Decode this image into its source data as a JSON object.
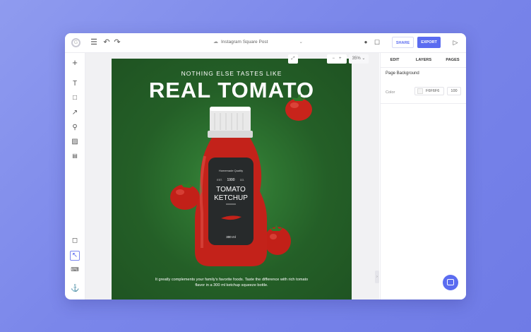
{
  "header": {
    "document_title": "Instagram Square Post",
    "share_label": "SHARE",
    "export_label": "EXPORT"
  },
  "zoom": {
    "level": "35%"
  },
  "poster": {
    "tagline": "NOTHING ELSE TASTES LIKE",
    "headline": "REAL TOMATO",
    "body": "It greatly complements your family's favorite foods. Taste the difference with rich tomato flavor in a 300 ml ketchup squeeze bottle.",
    "label": {
      "brand_top": "Homemade Quality",
      "est": "EST.",
      "year": "1990",
      "co": "CO.",
      "product_line1": "TOMATO",
      "product_line2": "KETCHUP",
      "volume": "300 ml"
    },
    "background_color": "#245f27"
  },
  "panel": {
    "tabs": [
      "EDIT",
      "LAYERS",
      "PAGES"
    ],
    "section_title": "Page Background",
    "color_label": "Color",
    "color_value": "F6F6F6",
    "opacity_value": "100"
  },
  "colors": {
    "accent": "#5b6cf0",
    "page_bg": "#8f9bef"
  }
}
